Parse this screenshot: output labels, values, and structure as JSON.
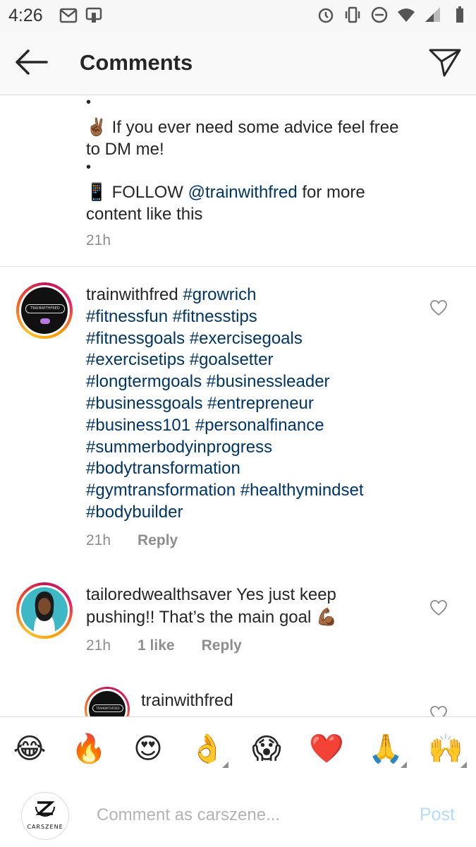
{
  "status_bar": {
    "time": "4:26",
    "icons_left": [
      "gmail-icon",
      "notification-icon"
    ],
    "icons_right": [
      "alarm-icon",
      "vibrate-icon",
      "dnd-icon",
      "wifi-icon",
      "signal-icon",
      "battery-icon"
    ]
  },
  "header": {
    "title": "Comments",
    "back_icon": "arrow-left-icon",
    "share_icon": "paper-plane-icon"
  },
  "caption_continuation": {
    "dot1": "•",
    "line_advice_emoji": "✌🏾",
    "line_advice": "If you ever need some advice feel free",
    "line_advice_2": "to DM me!",
    "dot2": "•",
    "line_follow_emoji": "📱",
    "line_follow_prefix": "FOLLOW",
    "line_follow_mention": "@trainwithfred",
    "line_follow_suffix": "for more",
    "line_follow_2": "content like this",
    "time": "21h"
  },
  "comments": [
    {
      "username": "trainwithfred",
      "lines": [
        "#growrich",
        "#fitnessfun #fitnesstips",
        "#fitnessgoals #exercisegoals",
        "#exercisetips #goalsetter",
        "#longtermgoals #businessleader",
        "#businessgoals #entrepreneur",
        "#business101 #personalfinance",
        "#summerbodyinprogress",
        "#bodytransformation",
        "#gymtransformation #healthymindset",
        "#bodybuilder"
      ],
      "time": "21h",
      "reply": "Reply"
    },
    {
      "username": "tailoredwealthsaver",
      "text_line1": "Yes just keep",
      "text_line2": "pushing!! That’s the main goal",
      "emoji": "💪🏾",
      "time": "21h",
      "likes": "1 like",
      "reply": "Reply"
    },
    {
      "username": "trainwithfred"
    }
  ],
  "emoji_bar": [
    {
      "char": "😂",
      "name": "tears-of-joy-emoji"
    },
    {
      "char": "🔥",
      "name": "fire-emoji"
    },
    {
      "char": "😍",
      "name": "heart-eyes-emoji"
    },
    {
      "char": "👌",
      "name": "ok-hand-emoji"
    },
    {
      "char": "😱",
      "name": "scream-emoji"
    },
    {
      "char": "❤️",
      "name": "red-heart-emoji"
    },
    {
      "char": "🙏",
      "name": "folded-hands-emoji"
    },
    {
      "char": "🙌",
      "name": "raised-hands-emoji"
    }
  ],
  "composer": {
    "avatar_label": "CARSZENE",
    "placeholder": "Comment as carszene...",
    "post_label": "Post"
  },
  "colors": {
    "link": "#003569",
    "meta": "#8e8e8e",
    "post_disabled": "#b3dbff"
  }
}
